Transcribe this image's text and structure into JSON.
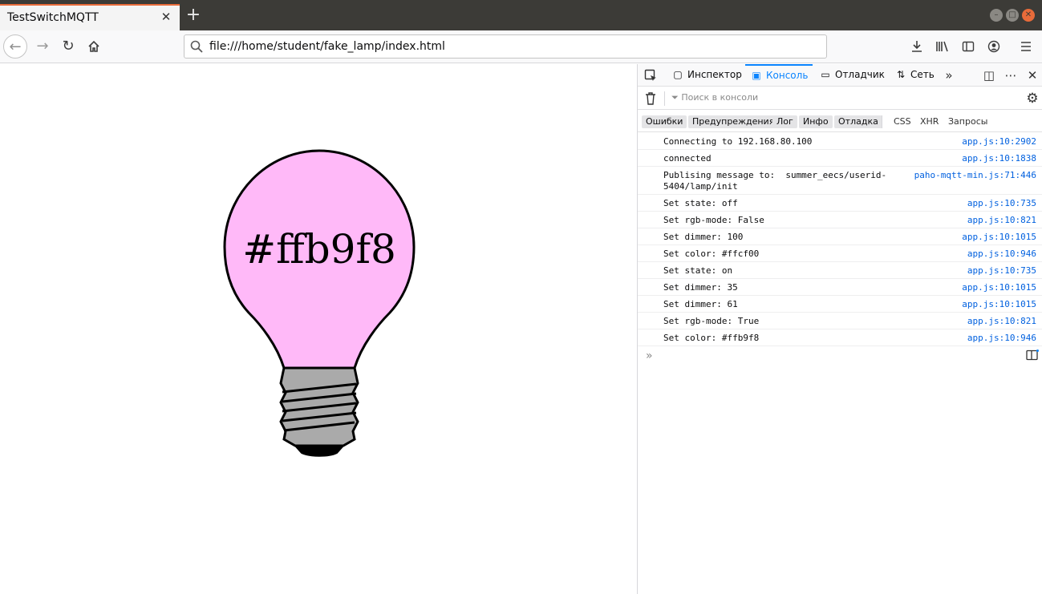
{
  "browser": {
    "tab_title": "TestSwitchMQTT",
    "tab_close_glyph": "✕",
    "new_tab_glyph": "+",
    "url": "file:///home/student/fake_lamp/index.html"
  },
  "lamp": {
    "color_label": "#ffb9f8",
    "fill_color": "#ffb9f8",
    "base_color": "#aaaaaa"
  },
  "devtools": {
    "tabs": [
      {
        "label": "Инспектор",
        "icon": "inspector-icon"
      },
      {
        "label": "Консоль",
        "icon": "console-icon"
      },
      {
        "label": "Отладчик",
        "icon": "debugger-icon"
      },
      {
        "label": "Сеть",
        "icon": "network-icon"
      }
    ],
    "filter_placeholder": "Поиск в консоли",
    "levels": [
      "Ошибки",
      "Предупреждения",
      "Лог",
      "Инфо",
      "Отладка"
    ],
    "request_filters": [
      "CSS",
      "XHR",
      "Запросы"
    ],
    "messages": [
      {
        "text": "Connecting to 192.168.80.100",
        "source": "app.js:10:2902"
      },
      {
        "text": "connected",
        "source": "app.js:10:1838"
      },
      {
        "text": "Publising message to:  summer_eecs/userid-\n5404/lamp/init",
        "source": "paho-mqtt-min.js:71:446"
      },
      {
        "text": "Set state: off",
        "source": "app.js:10:735"
      },
      {
        "text": "Set rgb-mode: False",
        "source": "app.js:10:821"
      },
      {
        "text": "Set dimmer: 100",
        "source": "app.js:10:1015"
      },
      {
        "text": "Set color: #ffcf00",
        "source": "app.js:10:946"
      },
      {
        "text": "Set state: on",
        "source": "app.js:10:735"
      },
      {
        "text": "Set dimmer: 35",
        "source": "app.js:10:1015"
      },
      {
        "text": "Set dimmer: 61",
        "source": "app.js:10:1015"
      },
      {
        "text": "Set rgb-mode: True",
        "source": "app.js:10:821"
      },
      {
        "text": "Set color: #ffb9f8",
        "source": "app.js:10:946"
      }
    ],
    "prompt_glyph": "»"
  },
  "colors": {
    "accent": "#0a84ff",
    "tab_highlight": "#e86b3a",
    "link": "#0060df"
  }
}
